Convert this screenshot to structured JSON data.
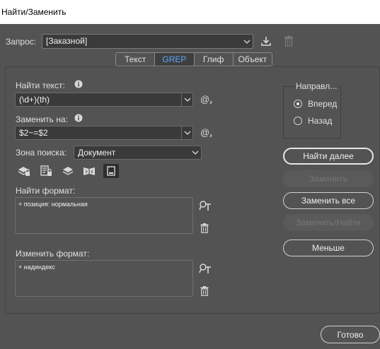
{
  "window": {
    "title": "Найти/Заменить"
  },
  "query": {
    "label": "Запрос:",
    "value": "[Заказной]"
  },
  "tabs": [
    {
      "label": "Текст"
    },
    {
      "label": "GREP"
    },
    {
      "label": "Глиф"
    },
    {
      "label": "Объект"
    }
  ],
  "find": {
    "label": "Найти текст:",
    "value": "(\\d+)(th)"
  },
  "replace": {
    "label": "Заменить на:",
    "value": "$2~=$2"
  },
  "search_scope": {
    "label": "Зона поиска:",
    "value": "Документ"
  },
  "find_format": {
    "label": "Найти формат:",
    "text": "+ позиция: нормальная"
  },
  "change_format": {
    "label": "Изменить формат:",
    "text": "+ надиндекс"
  },
  "direction": {
    "label": "Направл...",
    "options": [
      {
        "label": "Вперед",
        "checked": true
      },
      {
        "label": "Назад",
        "checked": false
      }
    ]
  },
  "buttons": {
    "find_next": "Найти далее",
    "replace": "Заменить",
    "replace_all": "Заменить все",
    "replace_find": "Заменить/Найти",
    "fewer": "Меньше",
    "done": "Готово"
  },
  "colors": {
    "accent": "#5aa9ff",
    "background": "#535353"
  }
}
